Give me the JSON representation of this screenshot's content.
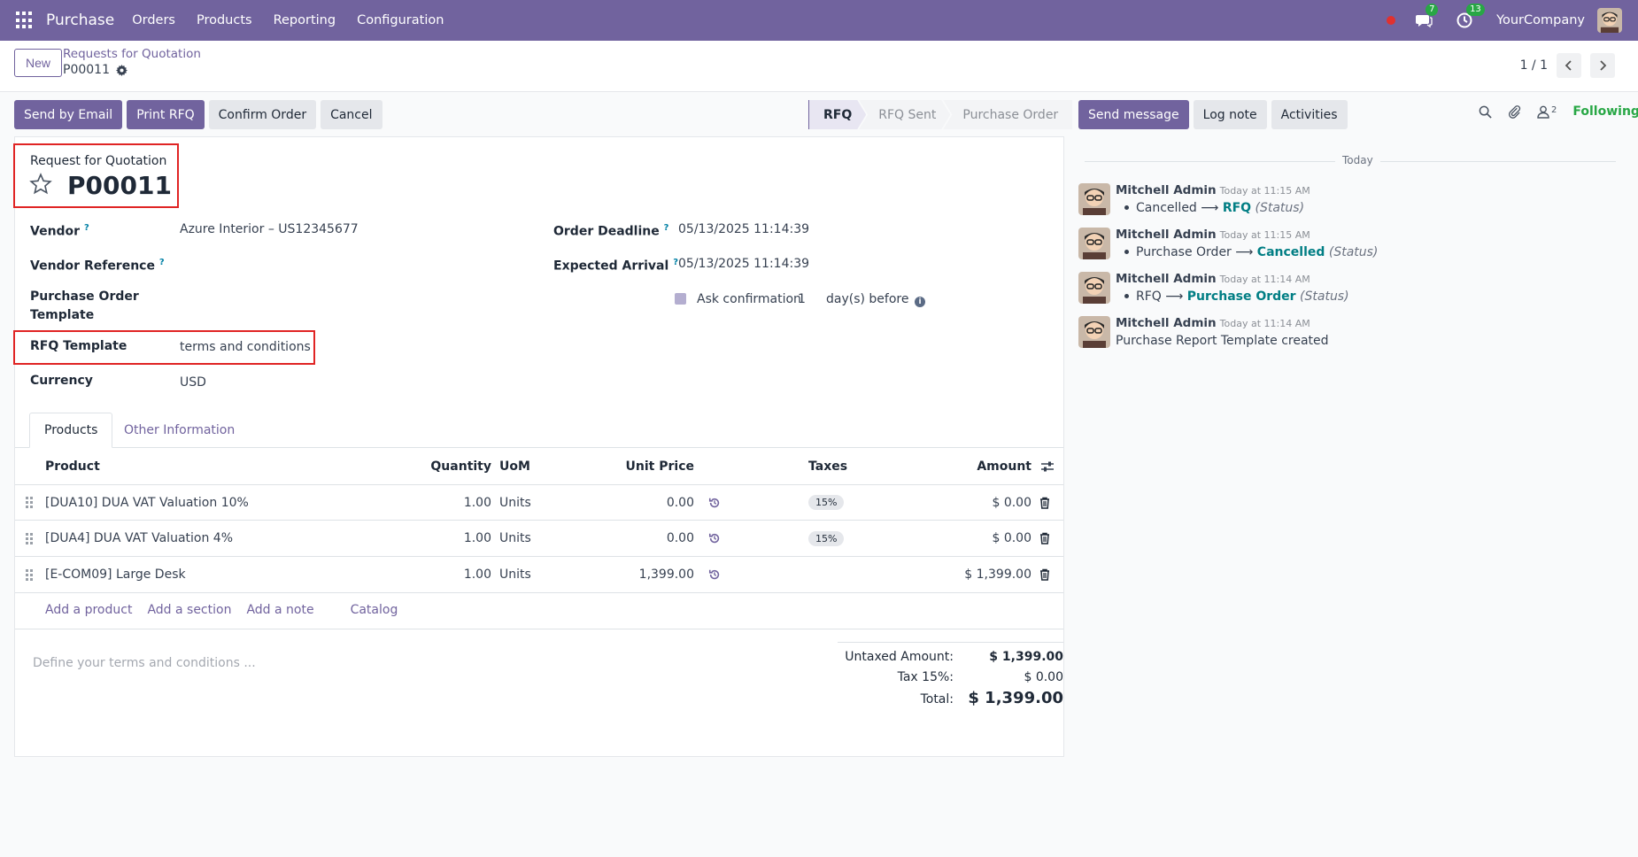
{
  "topbar": {
    "app_name": "Purchase",
    "menu": [
      "Orders",
      "Products",
      "Reporting",
      "Configuration"
    ],
    "chat_count": "7",
    "activity_count": "13",
    "company": "YourCompany"
  },
  "control": {
    "new_label": "New",
    "breadcrumb": "Requests for Quotation",
    "record": "P00011",
    "pager": "1 / 1"
  },
  "actions": {
    "send_email": "Send by Email",
    "print_rfq": "Print RFQ",
    "confirm": "Confirm Order",
    "cancel": "Cancel"
  },
  "status_stages": [
    "RFQ",
    "RFQ Sent",
    "Purchase Order"
  ],
  "form": {
    "doc_label": "Request for Quotation",
    "doc_number": "P00011",
    "vendor_label": "Vendor",
    "vendor_value": "Azure Interior – US12345677",
    "vendor_ref_label": "Vendor Reference",
    "po_template_label_1": "Purchase Order",
    "po_template_label_2": "Template",
    "rfq_template_label": "RFQ Template",
    "rfq_template_value": "terms and conditions",
    "currency_label": "Currency",
    "currency_value": "USD",
    "order_deadline_label": "Order Deadline",
    "order_deadline_value": "05/13/2025 11:14:39",
    "expected_arrival_label": "Expected Arrival",
    "expected_arrival_value": "05/13/2025 11:14:39",
    "ask_confirmation_label": "Ask confirmation",
    "ask_confirmation_days": "1",
    "days_before": "day(s) before"
  },
  "tabs": [
    "Products",
    "Other Information"
  ],
  "table": {
    "headers": {
      "product": "Product",
      "quantity": "Quantity",
      "uom": "UoM",
      "unit_price": "Unit Price",
      "taxes": "Taxes",
      "amount": "Amount"
    },
    "rows": [
      {
        "product": "[DUA10] DUA VAT Valuation 10%",
        "quantity": "1.00",
        "uom": "Units",
        "unit_price": "0.00",
        "tax": "15%",
        "amount": "$ 0.00"
      },
      {
        "product": "[DUA4] DUA VAT Valuation 4%",
        "quantity": "1.00",
        "uom": "Units",
        "unit_price": "0.00",
        "tax": "15%",
        "amount": "$ 0.00"
      },
      {
        "product": "[E-COM09] Large Desk",
        "quantity": "1.00",
        "uom": "Units",
        "unit_price": "1,399.00",
        "tax": "",
        "amount": "$ 1,399.00"
      }
    ],
    "add_links": [
      "Add a product",
      "Add a section",
      "Add a note",
      "Catalog"
    ]
  },
  "terms_placeholder": "Define your terms and conditions ...",
  "totals": {
    "untaxed_label": "Untaxed Amount:",
    "untaxed_value": "$ 1,399.00",
    "tax_label": "Tax 15%:",
    "tax_value": "$ 0.00",
    "total_label": "Total:",
    "total_value": "$ 1,399.00"
  },
  "chatter": {
    "send_message": "Send message",
    "log_note": "Log note",
    "activities": "Activities",
    "follower_count": "2",
    "following": "Following",
    "date_separator": "Today",
    "messages": [
      {
        "author": "Mitchell Admin",
        "date": "Today at 11:15 AM",
        "from": "Cancelled",
        "to": "RFQ",
        "field": "(Status)"
      },
      {
        "author": "Mitchell Admin",
        "date": "Today at 11:15 AM",
        "from": "Purchase Order",
        "to": "Cancelled",
        "field": "(Status)"
      },
      {
        "author": "Mitchell Admin",
        "date": "Today at 11:14 AM",
        "from": "RFQ",
        "to": "Purchase Order",
        "field": "(Status)"
      },
      {
        "author": "Mitchell Admin",
        "date": "Today at 11:14 AM",
        "text": "Purchase Report Template created"
      }
    ]
  },
  "colors": {
    "brand": "#71639e",
    "highlight": "#e02424",
    "following": "#28a745",
    "link": "#017e84"
  }
}
